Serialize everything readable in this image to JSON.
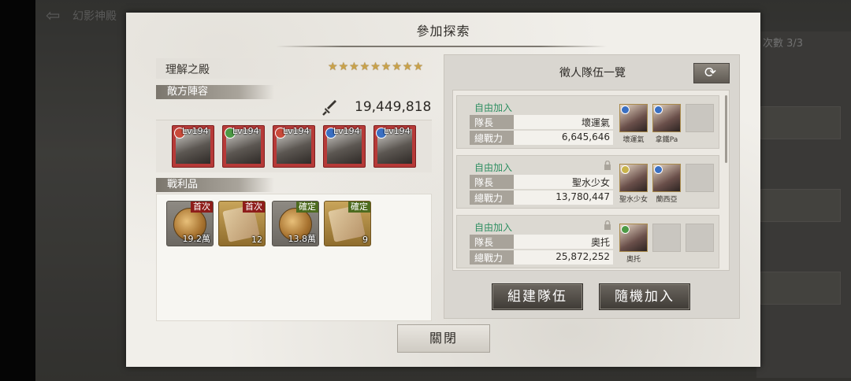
{
  "background": {
    "back_label": "幻影神殿",
    "right_tag": "次數 3/3"
  },
  "dialog": {
    "title": "參加探索",
    "stage": {
      "name": "理解之殿",
      "stars": "★★★★★★★★★",
      "star_count": 9
    },
    "enemy_header": "敵方陣容",
    "enemy_power": "19,449,818",
    "enemies": [
      {
        "lv": "Lv194",
        "element": "fire",
        "color": "#c94a3a"
      },
      {
        "lv": "Lv194",
        "element": "wind",
        "color": "#4c9a45"
      },
      {
        "lv": "Lv194",
        "element": "fire",
        "color": "#c94a3a"
      },
      {
        "lv": "Lv194",
        "element": "water",
        "color": "#3a6fc2"
      },
      {
        "lv": "Lv194",
        "element": "water",
        "color": "#3a6fc2"
      }
    ],
    "loot_header": "戰利品",
    "loot": [
      {
        "tag": "首次",
        "qty": "19.2萬",
        "item": "coin-icon"
      },
      {
        "tag": "首次",
        "qty": "12",
        "item": "chest-icon"
      },
      {
        "tag": "確定",
        "qty": "13.8萬",
        "item": "coin-icon"
      },
      {
        "tag": "確定",
        "qty": "9",
        "item": "chest-icon"
      }
    ],
    "recruit": {
      "title": "徵人隊伍一覽",
      "teams": [
        {
          "status": "自由加入",
          "leader_label": "隊長",
          "leader": "壞運氣",
          "power_label": "總戰力",
          "power": "6,645,646",
          "members": [
            "壞運氣",
            "拿鐵Pa"
          ],
          "locked": false
        },
        {
          "status": "自由加入",
          "leader_label": "隊長",
          "leader": "聖水少女",
          "power_label": "總戰力",
          "power": "13,780,447",
          "members": [
            "聖水少女",
            "蘭西亞"
          ],
          "locked": true
        },
        {
          "status": "自由加入",
          "leader_label": "隊長",
          "leader": "奧托",
          "power_label": "總戰力",
          "power": "25,872,252",
          "members": [
            "奧托"
          ],
          "locked": true
        }
      ],
      "build_team_label": "組建隊伍",
      "random_join_label": "隨機加入"
    },
    "close_label": "關閉"
  }
}
